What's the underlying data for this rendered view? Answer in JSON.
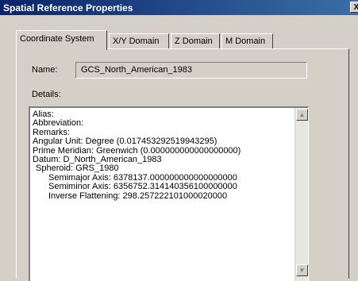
{
  "window": {
    "title": "Spatial Reference Properties",
    "close_label": "X"
  },
  "tabs": [
    {
      "label": "Coordinate System",
      "active": true
    },
    {
      "label": "X/Y Domain",
      "active": false
    },
    {
      "label": "Z Domain",
      "active": false
    },
    {
      "label": "M Domain",
      "active": false
    }
  ],
  "form": {
    "name_label": "Name:",
    "name_value": "GCS_North_American_1983",
    "details_label": "Details:"
  },
  "details_lines": [
    "Alias:",
    "Abbreviation:",
    "Remarks:",
    "Angular Unit: Degree (0.017453292519943295)",
    "Prime Meridian: Greenwich (0.000000000000000000)",
    "Datum: D_North_American_1983",
    "Spheroid: GRS_1980",
    "Semimajor Axis: 6378137.000000000000000000",
    "Semiminor Axis: 6356752.314140356100000000",
    "Inverse Flattening: 298.257222101000020000"
  ],
  "icons": {
    "scroll_up": "scroll-up-arrow-icon",
    "scroll_down": "scroll-down-arrow-icon"
  }
}
